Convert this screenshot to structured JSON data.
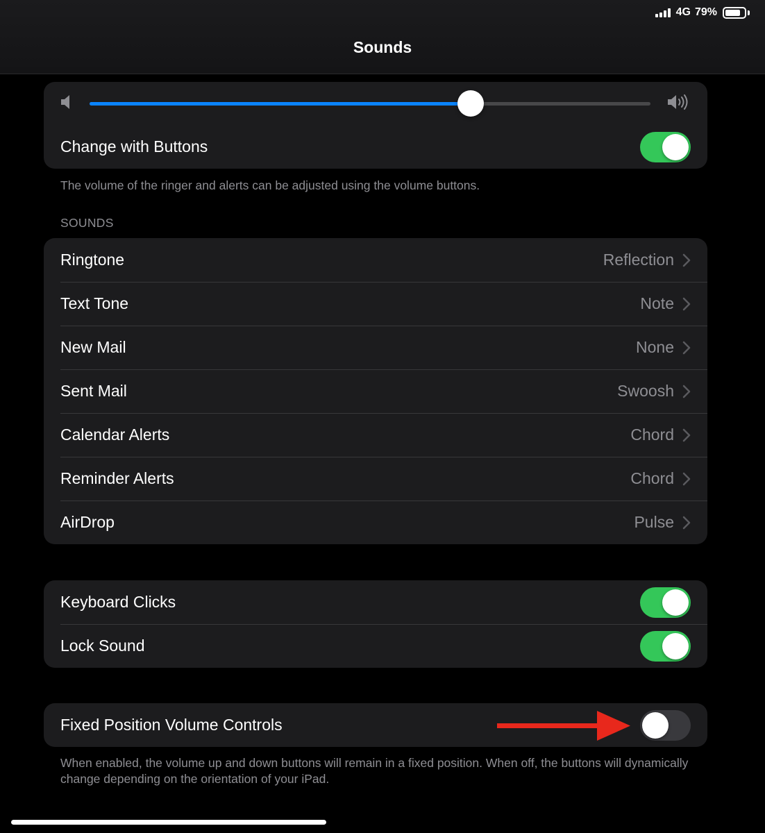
{
  "status_bar": {
    "network": "4G",
    "battery": "79%",
    "battery_level": 0.79
  },
  "nav": {
    "title": "Sounds"
  },
  "ringer": {
    "volume": 0.68,
    "change_with_buttons": {
      "label": "Change with Buttons",
      "on": true
    },
    "footnote": "The volume of the ringer and alerts can be adjusted using the volume buttons."
  },
  "sounds": {
    "header": "SOUNDS",
    "items": [
      {
        "label": "Ringtone",
        "value": "Reflection"
      },
      {
        "label": "Text Tone",
        "value": "Note"
      },
      {
        "label": "New Mail",
        "value": "None"
      },
      {
        "label": "Sent Mail",
        "value": "Swoosh"
      },
      {
        "label": "Calendar Alerts",
        "value": "Chord"
      },
      {
        "label": "Reminder Alerts",
        "value": "Chord"
      },
      {
        "label": "AirDrop",
        "value": "Pulse"
      }
    ]
  },
  "feedback": {
    "keyboard_clicks": {
      "label": "Keyboard Clicks",
      "on": true
    },
    "lock_sound": {
      "label": "Lock Sound",
      "on": true
    }
  },
  "fixed_position": {
    "label": "Fixed Position Volume Controls",
    "on": false,
    "footnote": "When enabled, the volume up and down buttons will remain in a fixed position. When off, the buttons will dynamically change depending on the orientation of your iPad."
  },
  "colors": {
    "accent": "#0a84ff",
    "toggle_on": "#34c759",
    "annotation_arrow": "#e8281c"
  }
}
